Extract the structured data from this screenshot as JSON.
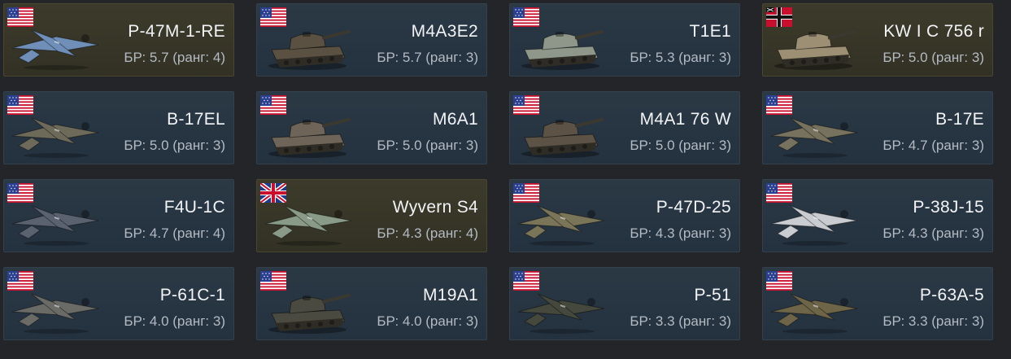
{
  "vehicles": [
    {
      "name": "P-47M-1-RE",
      "br": "БР: 5.7 (ранг: 4)",
      "flag": "usa-flag-icon",
      "kind": "plane",
      "premium": true,
      "tint": "#6f8fb8"
    },
    {
      "name": "M4A3E2",
      "br": "БР: 5.7 (ранг: 3)",
      "flag": "usa-flag-icon",
      "kind": "tank",
      "premium": false,
      "tint": "#5a5142"
    },
    {
      "name": "T1E1",
      "br": "БР: 5.3 (ранг: 3)",
      "flag": "usa-flag-icon",
      "kind": "tank",
      "premium": false,
      "tint": "#8e978a"
    },
    {
      "name": "KW I C 756 r",
      "br": "БР: 5.0 (ранг: 3)",
      "flag": "germany-flag-icon",
      "kind": "tank",
      "premium": true,
      "tint": "#9c8f74"
    },
    {
      "name": "B-17EL",
      "br": "БР: 5.0 (ранг: 3)",
      "flag": "usa-flag-icon",
      "kind": "plane",
      "premium": false,
      "tint": "#6d6a5a"
    },
    {
      "name": "M6A1",
      "br": "БР: 5.0 (ранг: 3)",
      "flag": "usa-flag-icon",
      "kind": "tank",
      "premium": false,
      "tint": "#6e6558"
    },
    {
      "name": "M4A1 76 W",
      "br": "БР: 5.0 (ранг: 3)",
      "flag": "usa-flag-icon",
      "kind": "tank",
      "premium": false,
      "tint": "#5c5346"
    },
    {
      "name": "B-17E",
      "br": "БР: 4.7 (ранг: 3)",
      "flag": "usa-flag-icon",
      "kind": "plane",
      "premium": false,
      "tint": "#77725e"
    },
    {
      "name": "F4U-1C",
      "br": "БР: 4.7 (ранг: 4)",
      "flag": "usa-flag-icon",
      "kind": "plane",
      "premium": false,
      "tint": "#5a6270"
    },
    {
      "name": "Wyvern S4",
      "br": "БР: 4.3 (ранг: 4)",
      "flag": "uk-flag-icon",
      "kind": "plane",
      "premium": true,
      "tint": "#8a9a88"
    },
    {
      "name": "P-47D-25",
      "br": "БР: 4.3 (ранг: 3)",
      "flag": "usa-flag-icon",
      "kind": "plane",
      "premium": false,
      "tint": "#7a7458"
    },
    {
      "name": "P-38J-15",
      "br": "БР: 4.3 (ранг: 3)",
      "flag": "usa-flag-icon",
      "kind": "plane",
      "premium": false,
      "tint": "#c9ccd0"
    },
    {
      "name": "P-61C-1",
      "br": "БР: 4.0 (ранг: 3)",
      "flag": "usa-flag-icon",
      "kind": "plane",
      "premium": false,
      "tint": "#6a6a66"
    },
    {
      "name": "M19A1",
      "br": "БР: 4.0 (ранг: 3)",
      "flag": "usa-flag-icon",
      "kind": "tank",
      "premium": false,
      "tint": "#4b4a40"
    },
    {
      "name": "P-51",
      "br": "БР: 3.3 (ранг: 3)",
      "flag": "usa-flag-icon",
      "kind": "plane",
      "premium": false,
      "tint": "#45483c"
    },
    {
      "name": "P-63A-5",
      "br": "БР: 3.3 (ранг: 3)",
      "flag": "usa-flag-icon",
      "kind": "plane",
      "premium": false,
      "tint": "#6e6448"
    }
  ]
}
